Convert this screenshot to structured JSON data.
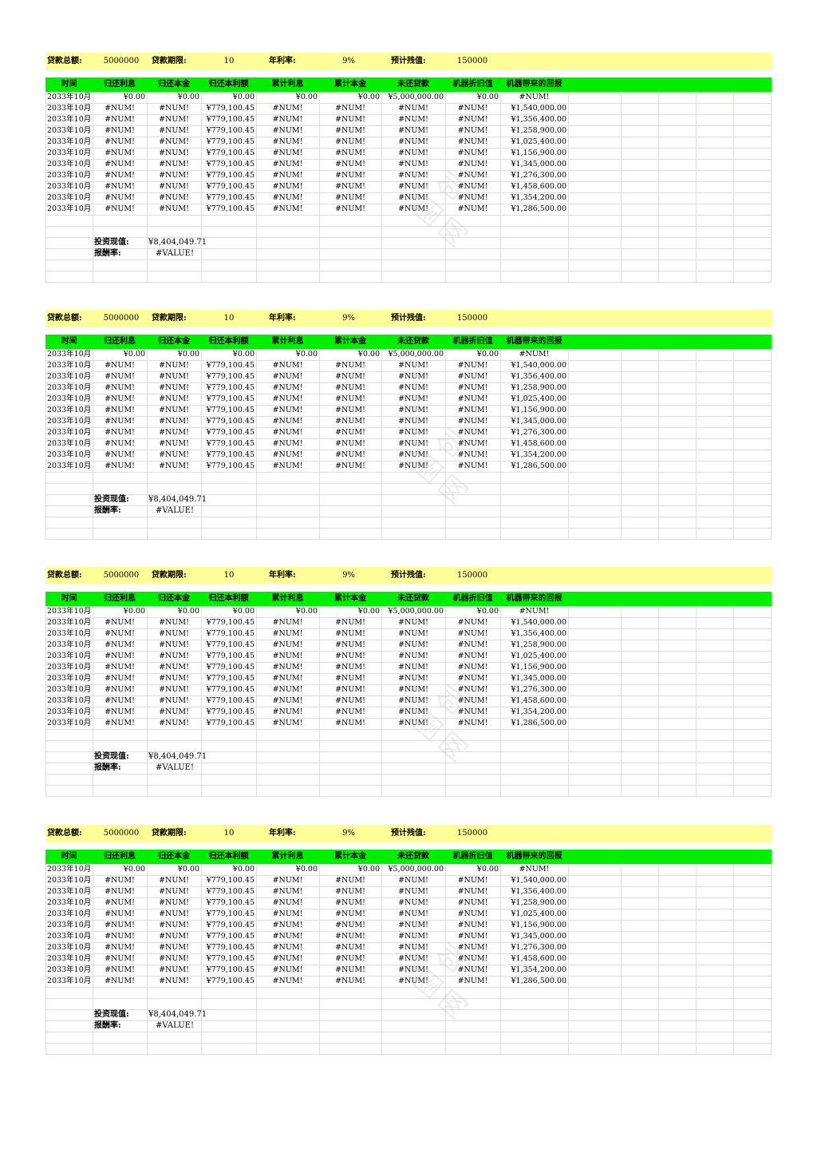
{
  "header": {
    "loan_total_label": "贷款总额:",
    "loan_total_value": "5000000",
    "loan_term_label": "贷款期限:",
    "loan_term_value": "10",
    "rate_label": "年利率:",
    "rate_value": "9%",
    "residual_label": "预计残值:",
    "residual_value": "150000"
  },
  "columns": [
    "时间",
    "归还利息",
    "归还本金",
    "归还本利额",
    "累计利息",
    "累计本金",
    "未还贷款",
    "机器折旧值",
    "机器带来的回报"
  ],
  "first_row": [
    "2033年10月",
    "¥0.00",
    "¥0.00",
    "¥0.00",
    "¥0.00",
    "¥0.00",
    "¥5,000,000.00",
    "¥0.00",
    "#NUM!"
  ],
  "rows": [
    [
      "2033年10月",
      "#NUM!",
      "#NUM!",
      "¥779,100.45",
      "#NUM!",
      "#NUM!",
      "#NUM!",
      "#NUM!",
      "¥1,540,000.00"
    ],
    [
      "2033年10月",
      "#NUM!",
      "#NUM!",
      "¥779,100.45",
      "#NUM!",
      "#NUM!",
      "#NUM!",
      "#NUM!",
      "¥1,356,400.00"
    ],
    [
      "2033年10月",
      "#NUM!",
      "#NUM!",
      "¥779,100.45",
      "#NUM!",
      "#NUM!",
      "#NUM!",
      "#NUM!",
      "¥1,258,900.00"
    ],
    [
      "2033年10月",
      "#NUM!",
      "#NUM!",
      "¥779,100.45",
      "#NUM!",
      "#NUM!",
      "#NUM!",
      "#NUM!",
      "¥1,025,400.00"
    ],
    [
      "2033年10月",
      "#NUM!",
      "#NUM!",
      "¥779,100.45",
      "#NUM!",
      "#NUM!",
      "#NUM!",
      "#NUM!",
      "¥1,156,900.00"
    ],
    [
      "2033年10月",
      "#NUM!",
      "#NUM!",
      "¥779,100.45",
      "#NUM!",
      "#NUM!",
      "#NUM!",
      "#NUM!",
      "¥1,345,000.00"
    ],
    [
      "2033年10月",
      "#NUM!",
      "#NUM!",
      "¥779,100.45",
      "#NUM!",
      "#NUM!",
      "#NUM!",
      "#NUM!",
      "¥1,276,300.00"
    ],
    [
      "2033年10月",
      "#NUM!",
      "#NUM!",
      "¥779,100.45",
      "#NUM!",
      "#NUM!",
      "#NUM!",
      "#NUM!",
      "¥1,458,600.00"
    ],
    [
      "2033年10月",
      "#NUM!",
      "#NUM!",
      "¥779,100.45",
      "#NUM!",
      "#NUM!",
      "#NUM!",
      "#NUM!",
      "¥1,354,200.00"
    ],
    [
      "2033年10月",
      "#NUM!",
      "#NUM!",
      "¥779,100.45",
      "#NUM!",
      "#NUM!",
      "#NUM!",
      "#NUM!",
      "¥1,286,500.00"
    ]
  ],
  "summary": {
    "pv_label": "投资现值:",
    "pv_value": "¥8,404,049.71",
    "return_label": "报酬率:",
    "return_value": "#VALUE!"
  },
  "watermark": "图创网",
  "colors": {
    "header_bg": "#ffff99",
    "column_header_bg": "#00ee00",
    "gridline": "#dcdcdc"
  }
}
